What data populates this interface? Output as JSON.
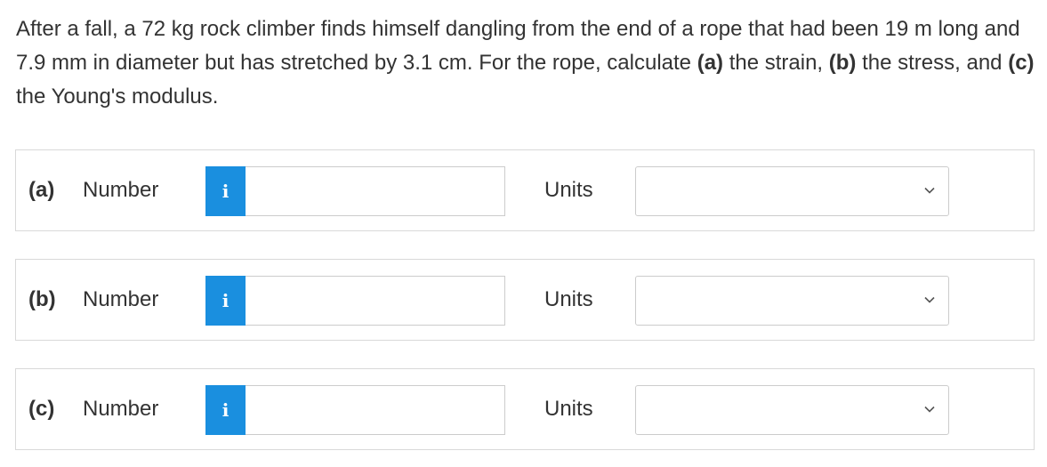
{
  "question": {
    "text_1": "After a fall, a 72 kg rock climber finds himself dangling from the end of a rope that had been 19 m long and 7.9 mm in diameter but has stretched by 3.1 cm. For the rope, calculate ",
    "part_a": "(a)",
    "text_2": " the strain, ",
    "part_b": "(b)",
    "text_3": " the stress, and ",
    "part_c": "(c)",
    "text_4": " the Young's modulus."
  },
  "rows": [
    {
      "part_label": "(a)",
      "number_label": "Number",
      "info_icon": "i",
      "number_value": "",
      "units_label": "Units",
      "units_selected": ""
    },
    {
      "part_label": "(b)",
      "number_label": "Number",
      "info_icon": "i",
      "number_value": "",
      "units_label": "Units",
      "units_selected": ""
    },
    {
      "part_label": "(c)",
      "number_label": "Number",
      "info_icon": "i",
      "number_value": "",
      "units_label": "Units",
      "units_selected": ""
    }
  ],
  "icons": {
    "info": "info-icon",
    "dropdown": "chevron-down-icon"
  },
  "colors": {
    "info_button": "#1a8fdf",
    "border": "#d9d9d9",
    "text": "#333333"
  }
}
